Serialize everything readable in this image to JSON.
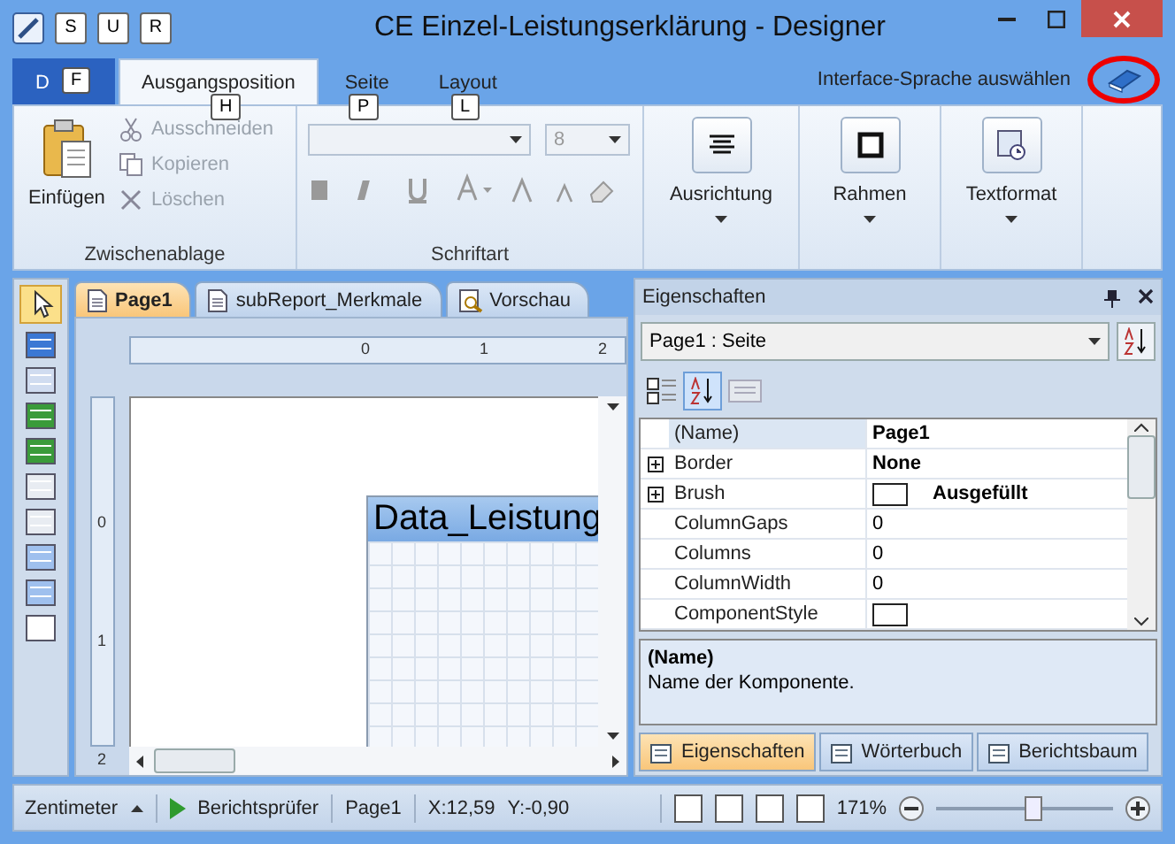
{
  "window": {
    "title": "CE Einzel-Leistungserklärung - Designer"
  },
  "quick_access_keytips": [
    "S",
    "U",
    "R"
  ],
  "ribbon_tabs": [
    {
      "label": "D",
      "keytip": "F",
      "kind": "file",
      "selected": false
    },
    {
      "label": "Ausgangsposition",
      "keytip": "H",
      "kind": "tab",
      "selected": true
    },
    {
      "label": "Seite",
      "keytip": "P",
      "kind": "tab",
      "selected": false
    },
    {
      "label": "Layout",
      "keytip": "L",
      "kind": "tab",
      "selected": false
    }
  ],
  "language_link": "Interface-Sprache auswählen",
  "clipboard": {
    "title": "Zwischenablage",
    "paste": "Einfügen",
    "items": [
      {
        "label": "Ausschneiden",
        "disabled": true
      },
      {
        "label": "Kopieren",
        "disabled": true
      },
      {
        "label": "Löschen",
        "disabled": true
      }
    ]
  },
  "font": {
    "title": "Schriftart",
    "size": "8"
  },
  "dropdown_buttons": [
    {
      "label": "Ausrichtung",
      "kind": "align"
    },
    {
      "label": "Rahmen",
      "kind": "border"
    },
    {
      "label": "Textformat",
      "kind": "format"
    }
  ],
  "document_tabs": [
    {
      "label": "Page1",
      "selected": true
    },
    {
      "label": "subReport_Merkmale",
      "selected": false
    },
    {
      "label": "Vorschau",
      "selected": false
    }
  ],
  "rulers": {
    "horizontal": [
      "0",
      "1",
      "2"
    ],
    "vertical": [
      "0",
      "1",
      "2"
    ]
  },
  "band": {
    "title": "Data_Leistung"
  },
  "properties": {
    "title": "Eigenschaften",
    "object": "Page1 : Seite",
    "rows": [
      {
        "name": "(Name)",
        "value": "Page1",
        "bold": true,
        "expandable": false,
        "swatch": false,
        "selected": true
      },
      {
        "name": "Border",
        "value": "None",
        "bold": true,
        "expandable": true,
        "swatch": false,
        "selected": false
      },
      {
        "name": "Brush",
        "value": "Ausgefüllt",
        "bold": true,
        "expandable": true,
        "swatch": true,
        "selected": false
      },
      {
        "name": "ColumnGaps",
        "value": "0",
        "bold": false,
        "expandable": false,
        "swatch": false,
        "selected": false
      },
      {
        "name": "Columns",
        "value": "0",
        "bold": false,
        "expandable": false,
        "swatch": false,
        "selected": false
      },
      {
        "name": "ColumnWidth",
        "value": "0",
        "bold": false,
        "expandable": false,
        "swatch": false,
        "selected": false
      },
      {
        "name": "ComponentStyle",
        "value": "",
        "bold": false,
        "expandable": false,
        "swatch": true,
        "selected": false
      }
    ],
    "description_title": "(Name)",
    "description": "Name der Komponente.",
    "tabs": [
      {
        "label": "Eigenschaften",
        "selected": true
      },
      {
        "label": "Wörterbuch",
        "selected": false
      },
      {
        "label": "Berichtsbaum",
        "selected": false
      }
    ]
  },
  "status_bar": {
    "unit": "Zentimeter",
    "checker": "Berichtsprüfer",
    "page": "Page1",
    "x": "X:12,59",
    "y": "Y:-0,90",
    "zoom": "171%",
    "level": 0.55
  }
}
